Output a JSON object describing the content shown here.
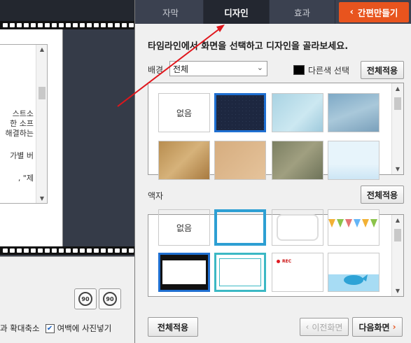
{
  "tabs": [
    {
      "label": "자막"
    },
    {
      "label": "디자인"
    },
    {
      "label": "효과"
    }
  ],
  "quick_make": {
    "icon": "chevron-left-icon",
    "label": "간편만들기"
  },
  "instruction": "타임라인에서 화면을 선택하고 디자인을 골라보세요.",
  "background": {
    "label": "배경",
    "select_value": "전체",
    "color_label": "다른색 선택",
    "apply_all": "전체적용",
    "tiles": [
      {
        "label": "없음"
      }
    ]
  },
  "frame": {
    "label": "액자",
    "apply_all": "전체적용",
    "tiles": [
      {
        "label": "없음"
      },
      {
        "label": "REC"
      }
    ]
  },
  "bottom_buttons": {
    "apply_all": "전체적용",
    "prev": "이전화면",
    "next": "다음화면"
  },
  "left_panel": {
    "doc_lines": [
      "스트소",
      "한 소프",
      "해결하는",
      "가별 버",
      ", \"제"
    ],
    "rotate_right_label": "90",
    "rotate_left_label": "90",
    "zoom_label": "과 확대축소",
    "margin_photo_label": "여백에 사진넣기"
  },
  "colors": {
    "accent": "#e8541e",
    "selection": "#1f6fd1",
    "tabbar": "#3b4150",
    "arrow": "#e0161c"
  }
}
